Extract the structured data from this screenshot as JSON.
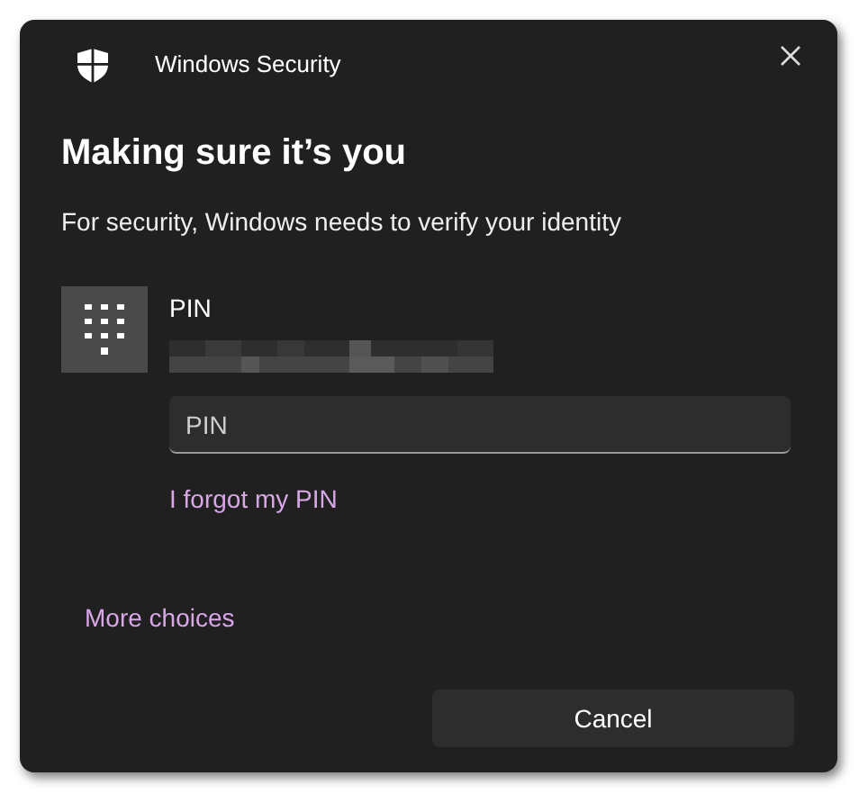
{
  "window": {
    "title": "Windows Security"
  },
  "heading": "Making sure it’s you",
  "subtitle": "For security, Windows needs to verify your identity",
  "credential": {
    "label": "PIN"
  },
  "pin_field": {
    "placeholder": "PIN"
  },
  "links": [
    "I forgot my PIN",
    "More choices"
  ],
  "buttons": [
    "Cancel"
  ]
}
